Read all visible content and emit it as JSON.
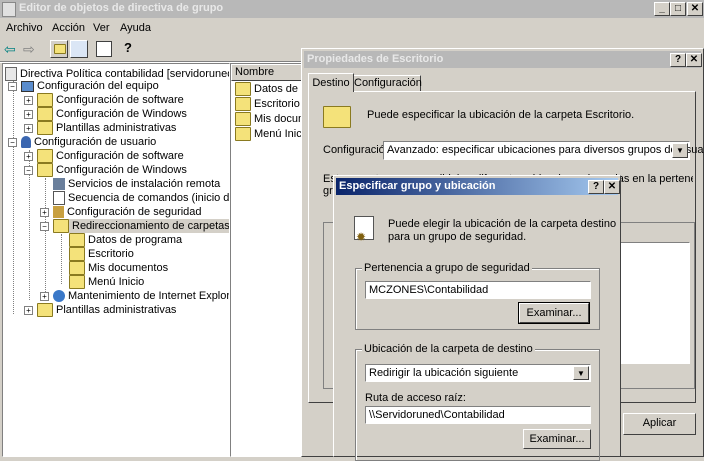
{
  "main_window": {
    "title": "Editor de objetos de directiva de grupo",
    "menu": [
      "Archivo",
      "Acción",
      "Ver",
      "Ayuda"
    ],
    "toolbar_icons": [
      "back-arrow-icon",
      "forward-arrow-icon",
      "up-folder-icon",
      "show-hide-tree-icon",
      "export-list-icon",
      "help-icon"
    ]
  },
  "tree": {
    "items": [
      {
        "label": "Directiva Política contabilidad [servidoruned.mcz",
        "icon": "policy-icon"
      },
      {
        "label": "Configuración del equipo",
        "icon": "computer-icon"
      },
      {
        "label": "Configuración de software",
        "icon": "folder-icon"
      },
      {
        "label": "Configuración de Windows",
        "icon": "folder-icon"
      },
      {
        "label": "Plantillas administrativas",
        "icon": "folder-icon"
      },
      {
        "label": "Configuración de usuario",
        "icon": "user-icon"
      },
      {
        "label": "Configuración de software",
        "icon": "folder-icon"
      },
      {
        "label": "Configuración de Windows",
        "icon": "folder-icon"
      },
      {
        "label": "Servicios de instalación remota",
        "icon": "install-icon"
      },
      {
        "label": "Secuencia de comandos (inicio de se",
        "icon": "script-icon"
      },
      {
        "label": "Configuración de seguridad",
        "icon": "security-icon"
      },
      {
        "label": "Redireccionamiento de carpetas",
        "icon": "folder-icon"
      },
      {
        "label": "Datos de programa",
        "icon": "folder-icon"
      },
      {
        "label": "Escritorio",
        "icon": "folder-icon"
      },
      {
        "label": "Mis documentos",
        "icon": "folder-icon"
      },
      {
        "label": "Menú Inicio",
        "icon": "folder-icon"
      },
      {
        "label": "Mantenimiento de Internet Explorer",
        "icon": "ie-icon"
      },
      {
        "label": "Plantillas administrativas",
        "icon": "folder-icon"
      }
    ]
  },
  "list": {
    "column_header": "Nombre",
    "items": [
      "Datos de pr",
      "Escritorio",
      "Mis documer",
      "Menú Inicio"
    ]
  },
  "props_dialog": {
    "title": "Propiedades de Escritorio",
    "tabs": [
      "Destino",
      "Configuración"
    ],
    "info_text": "Puede especificar la ubicación de la carpeta Escritorio.",
    "config_label": "Configuración:",
    "config_value": "Avanzado: especificar ubicaciones para diversos grupos de usuarios",
    "hidden_text_line1": "Esta carpeta se va a redirigir a diferentes ubicaciones basadas en la pertenencia a",
    "hidden_text_line2": "gru",
    "apply_button": "Aplicar"
  },
  "group_dialog": {
    "title": "Especificar grupo y ubicación",
    "info_line1": "Puede elegir la ubicación de la carpeta destino",
    "info_line2": "para un grupo de seguridad.",
    "membership_legend": "Pertenencia a grupo de seguridad",
    "group_value": "MCZONES\\Contabilidad",
    "browse1": "Examinar...",
    "location_legend": "Ubicación de la carpeta de destino",
    "location_value": "Redirigir la ubicación siguiente",
    "root_path_label": "Ruta de acceso raíz:",
    "root_path_value": "\\\\Servidoruned\\Contabilidad",
    "browse2": "Examinar..."
  }
}
